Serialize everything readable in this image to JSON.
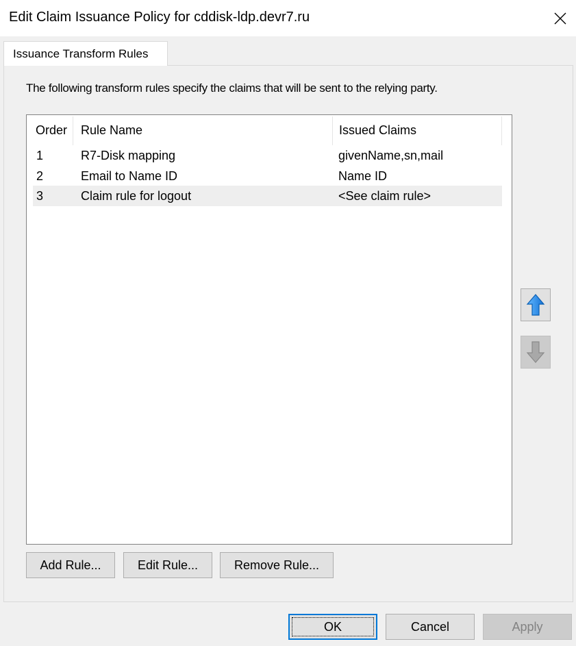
{
  "window": {
    "title": "Edit Claim Issuance Policy for cddisk-ldp.devr7.ru",
    "close_icon": "close-icon"
  },
  "tabs": [
    {
      "label": "Issuance Transform Rules",
      "active": true
    }
  ],
  "panel": {
    "description": "The following transform rules specify the claims that will be sent to the relying party."
  },
  "rules_table": {
    "columns": [
      "Order",
      "Rule Name",
      "Issued Claims"
    ],
    "rows": [
      {
        "order": "1",
        "rule_name": "R7-Disk mapping",
        "issued_claims": "givenName,sn,mail",
        "selected": false
      },
      {
        "order": "2",
        "rule_name": "Email to Name ID",
        "issued_claims": "Name ID",
        "selected": false
      },
      {
        "order": "3",
        "rule_name": "Claim rule for logout",
        "issued_claims": "<See claim rule>",
        "selected": true
      }
    ]
  },
  "move_buttons": {
    "up": {
      "icon": "arrow-up-icon",
      "enabled": true,
      "color": "#1e90ff"
    },
    "down": {
      "icon": "arrow-down-icon",
      "enabled": false,
      "color": "#9a9a9a"
    }
  },
  "rule_buttons": {
    "add": "Add Rule...",
    "edit": "Edit Rule...",
    "remove": "Remove Rule..."
  },
  "dialog_buttons": {
    "ok": "OK",
    "cancel": "Cancel",
    "apply": "Apply"
  },
  "colors": {
    "dialog_bg": "#f0f0f0",
    "selected_row": "#eeeeee",
    "focus_accent": "#0078d7"
  }
}
